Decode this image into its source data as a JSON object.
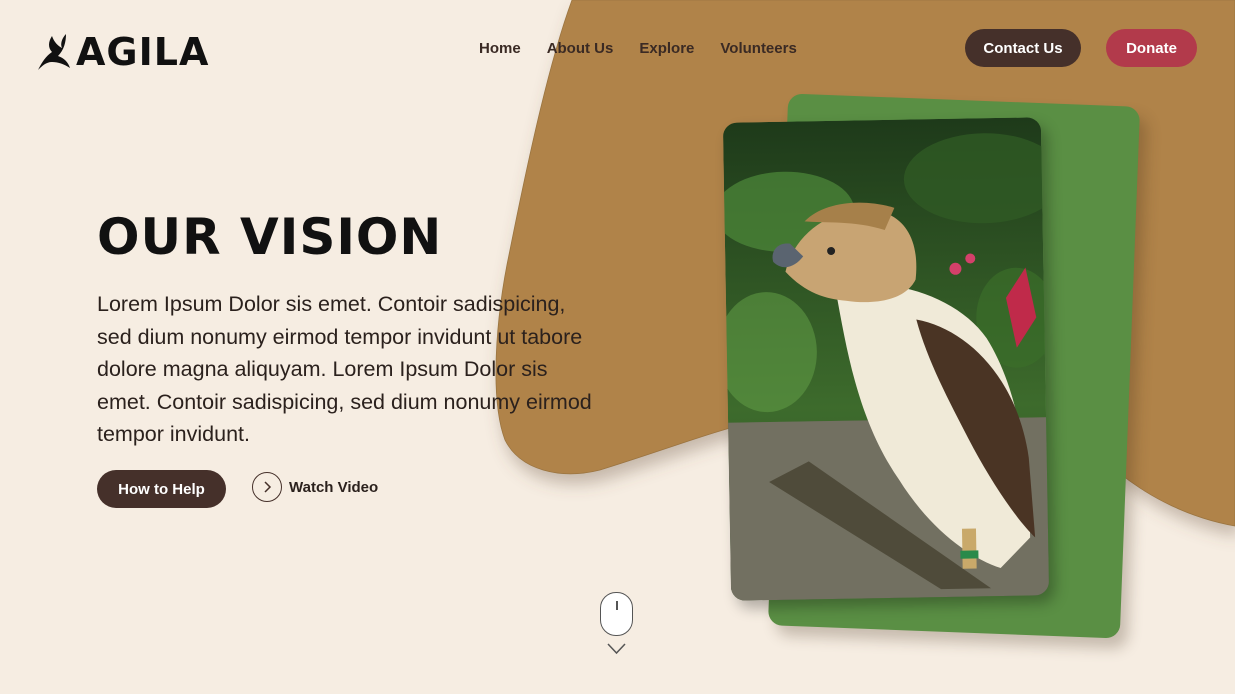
{
  "brand": {
    "name": "AGILA",
    "logo_icon": "eagle-icon"
  },
  "nav": {
    "items": [
      {
        "label": "Home"
      },
      {
        "label": "About Us"
      },
      {
        "label": "Explore"
      },
      {
        "label": "Volunteers"
      }
    ]
  },
  "actions": {
    "contact": "Contact Us",
    "donate": "Donate"
  },
  "hero": {
    "heading": "OUR VISION",
    "body": "Lorem Ipsum Dolor sis emet. Contoir sadispicing, sed dium nonumy eirmod tempor invidunt ut tabore dolore magna aliquyam. Lorem Ipsum Dolor sis emet. Contoir sadispicing, sed dium nonumy eirmod tempor invidunt.",
    "primary_button": "How to Help",
    "video_button": "Watch Video",
    "video_icon": "play-chevron-icon"
  },
  "media": {
    "image_subject": "eagle-photo"
  },
  "scroll_indicator": {
    "icon": "mouse-icon",
    "arrow_icon": "chevron-down-icon"
  },
  "colors": {
    "background": "#f6ede2",
    "accent_tan": "#b08349",
    "card_green": "#5a8f44",
    "dark_brown": "#45302a",
    "donate_red": "#b23a4b"
  }
}
